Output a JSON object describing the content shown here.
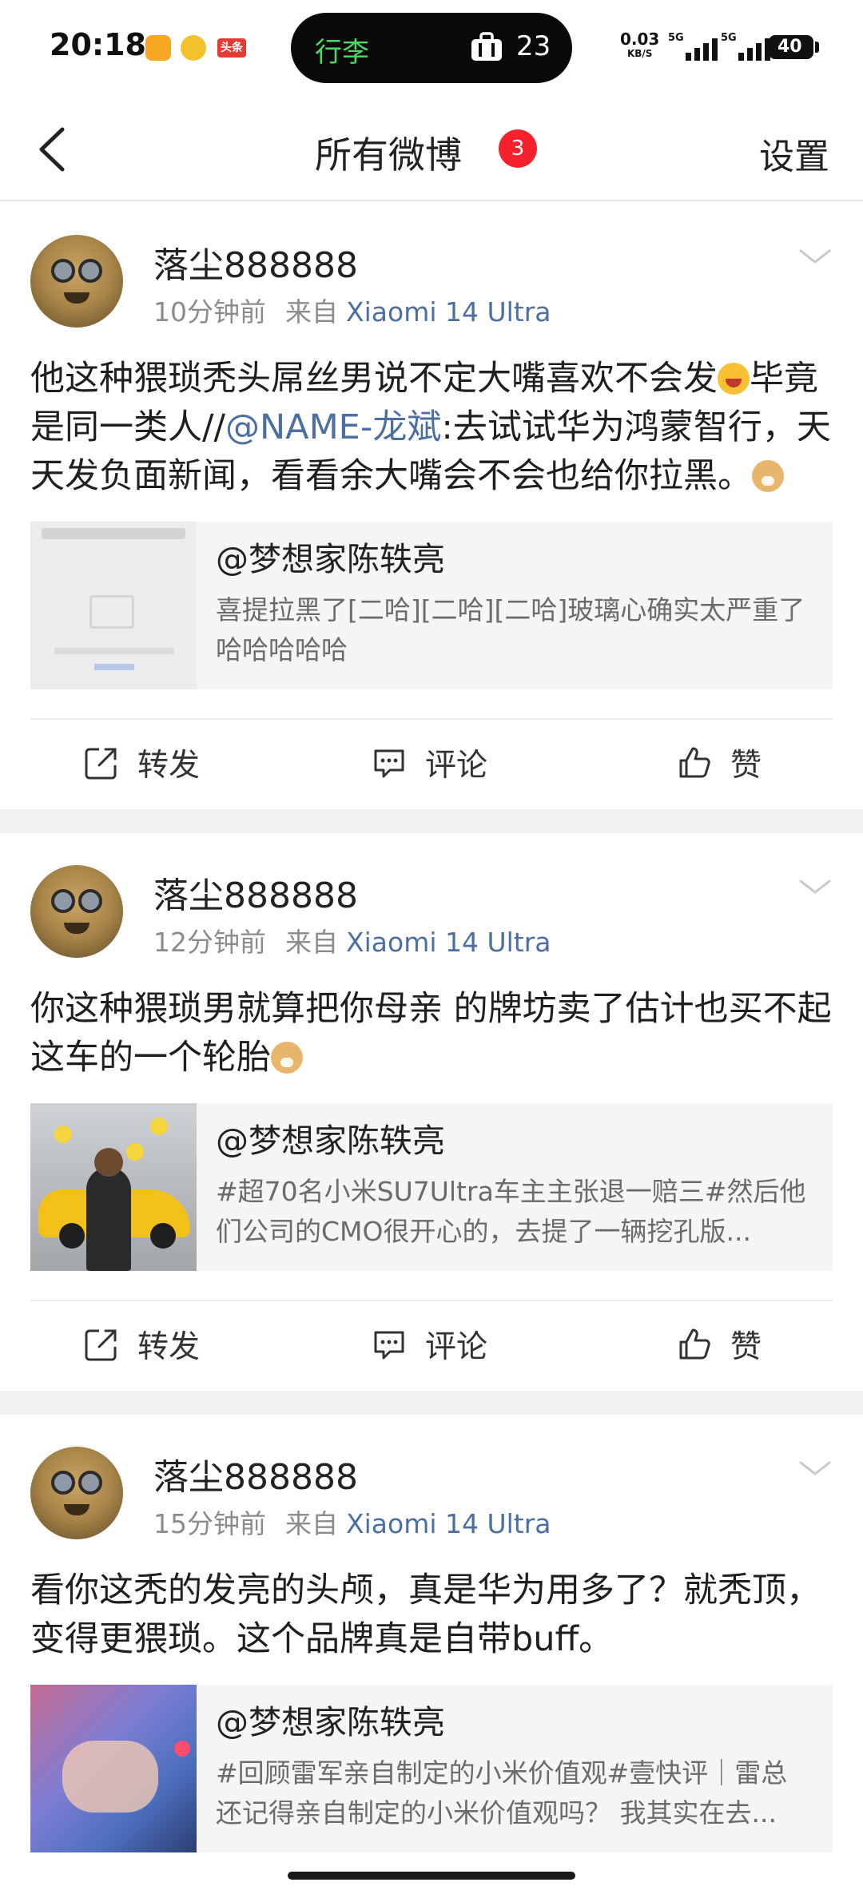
{
  "status_bar": {
    "time": "20:18",
    "island_label": "行李",
    "island_count": "23",
    "net_speed": "0.03",
    "net_unit": "KB/S",
    "signal_1": "5G",
    "signal_2": "5G",
    "battery": "40",
    "battery_level": 0.4,
    "app_badge": "头条"
  },
  "nav": {
    "title": "所有微博",
    "badge": "3",
    "settings": "设置"
  },
  "actions": {
    "repost": "转发",
    "comment": "评论",
    "like": "赞"
  },
  "posts": [
    {
      "author": "落尘888888",
      "time": "10分钟前",
      "from": "来自",
      "device": "Xiaomi 14 Ultra",
      "text_1": "他这种猥琐秃头屌丝男说不定大嘴喜欢不会发",
      "text_2": "毕竟是同一类人//",
      "mention": "@NAME-龙斌",
      "text_3": ":去试试华为鸿蒙智行，天天发负面新闻，看看余大嘴会不会也给你拉黑。",
      "quote_author": "@梦想家陈轶亮",
      "quote_text": "喜提拉黑了[二哈][二哈][二哈]玻璃心确实太严重了哈哈哈哈哈"
    },
    {
      "author": "落尘888888",
      "time": "12分钟前",
      "from": "来自",
      "device": "Xiaomi 14 Ultra",
      "text_1": "你这种猥琐男就算把你母亲 的牌坊卖了估计也买不起这车的一个轮胎",
      "quote_author": "@梦想家陈轶亮",
      "quote_text": "#超70名小米SU7Ultra车主主张退一赔三#然后他们公司的CMO很开心的，去提了一辆挖孔版..."
    },
    {
      "author": "落尘888888",
      "time": "15分钟前",
      "from": "来自",
      "device": "Xiaomi 14 Ultra",
      "text_1": "看你这秃的发亮的头颅，真是华为用多了？就秃顶，变得更猥琐。这个品牌真是自带buff。",
      "quote_author": "@梦想家陈轶亮",
      "quote_text": "#回顾雷军亲自制定的小米价值观#壹快评｜雷总还记得亲自制定的小米价值观吗？ 我其实在去..."
    }
  ]
}
